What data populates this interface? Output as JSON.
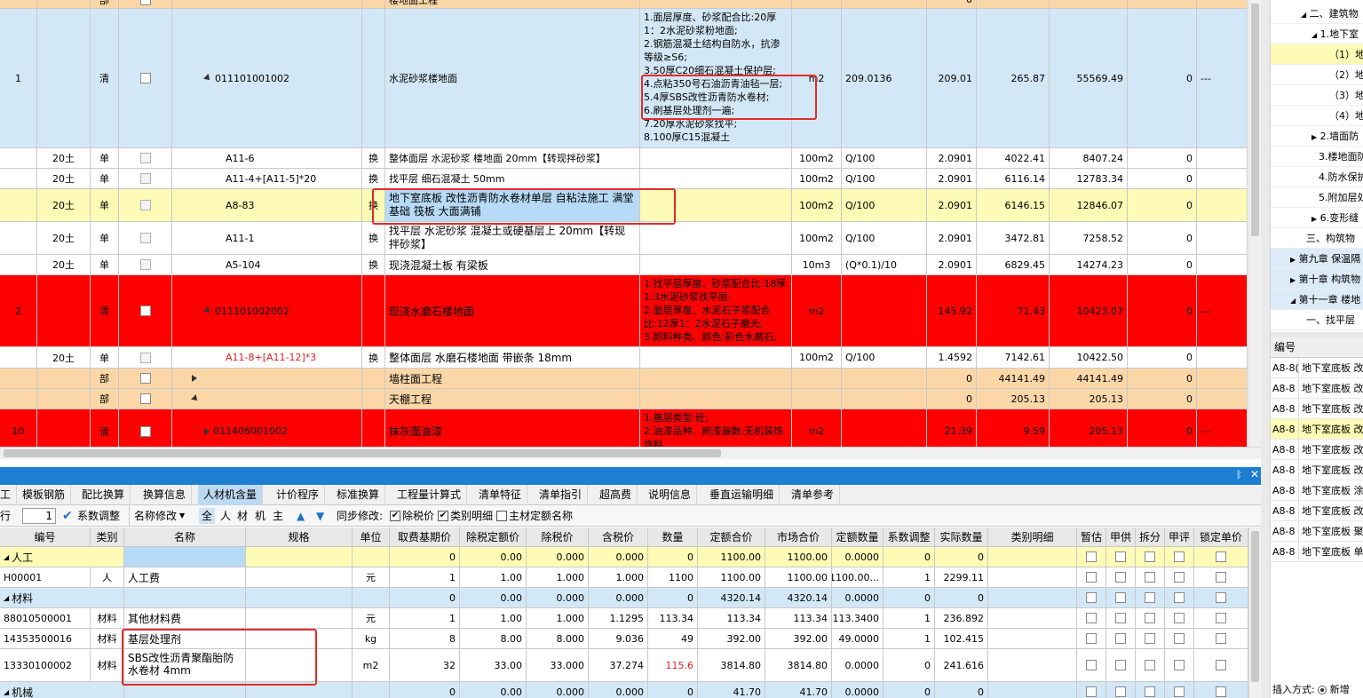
{
  "top_grid": {
    "rows": [
      {
        "code": "",
        "type": "部",
        "name": "楼地面工程",
        "amount": "0",
        "v1": "",
        "v2": ""
      },
      {
        "idx": "1",
        "type": "清",
        "code": "011101001002",
        "name": "水泥砂浆楼地面",
        "features": "1.面层厚度、砂浆配合比:20厚1：2水泥砂浆粉地面;\n2.钢筋混凝土结构自防水，抗渗等级≥S6;\n3.50厚C20细石混凝土保护层;\n4.点粘350号石油沥青油毡一层;\n5.4厚SBS改性沥青防水卷材;\n6.刷基层处理剂一遍;\n7.20厚水泥砂浆找平;\n8.100厚C15混凝土",
        "unit": "m2",
        "expr": "209.0136",
        "qty": "209.01",
        "price": "265.87",
        "total": "55569.49",
        "last": "0",
        "dash": "---"
      },
      {
        "major": "20土",
        "type": "单",
        "code": "A11-6",
        "huan": "换",
        "name": "整体面层 水泥砂浆 楼地面 20mm【转现拌砂浆】",
        "unit": "100m2",
        "expr": "Q/100",
        "qty": "2.0901",
        "price": "4022.41",
        "total": "8407.24",
        "last": "0"
      },
      {
        "major": "20土",
        "type": "单",
        "code": "A11-4+[A11-5]*20",
        "huan": "换",
        "name": "找平层 细石混凝土 50mm",
        "unit": "100m2",
        "expr": "Q/100",
        "qty": "2.0901",
        "price": "6116.14",
        "total": "12783.34",
        "last": "0"
      },
      {
        "major": "20土",
        "type": "单",
        "code": "A8-83",
        "huan": "换",
        "name": "地下室底板 改性沥青防水卷材单层 自粘法施工 满堂基础 筏板 大面满铺",
        "unit": "100m2",
        "expr": "Q/100",
        "qty": "2.0901",
        "price": "6146.15",
        "total": "12846.07",
        "last": "0"
      },
      {
        "major": "20土",
        "type": "单",
        "code": "A11-1",
        "huan": "换",
        "name": "找平层 水泥砂浆 混凝土或硬基层上 20mm【转现拌砂浆】",
        "unit": "100m2",
        "expr": "Q/100",
        "qty": "2.0901",
        "price": "3472.81",
        "total": "7258.52",
        "last": "0"
      },
      {
        "major": "20土",
        "type": "单",
        "code": "A5-104",
        "huan": "换",
        "name": "现浇混凝土板 有梁板",
        "unit": "10m3",
        "expr": "(Q*0.1)/10",
        "qty": "2.0901",
        "price": "6829.45",
        "total": "14274.23",
        "last": "0"
      },
      {
        "idx": "2",
        "type": "清",
        "code": "011101002002",
        "name": "现浇水磨石楼地面",
        "features": "1.找平层厚度、砂浆配合比:18厚1:3水泥砂浆找平层;\n2.面层厚度、水泥石子浆配合比:12厚1：2水泥石子磨光;\n3.颜料种类、颜色:彩色水磨石;",
        "unit": "m2",
        "qty": "145.92",
        "price": "71.43",
        "total": "10423.07",
        "last": "0",
        "dash": "---"
      },
      {
        "major": "20土",
        "type": "单",
        "code": "A11-8+[A11-12]*3",
        "huan": "换",
        "name": "整体面层 水磨石楼地面 带嵌条 18mm",
        "unit": "100m2",
        "expr": "Q/100",
        "qty": "1.4592",
        "price": "7142.61",
        "total": "10422.50",
        "last": "0"
      },
      {
        "type": "部",
        "name": "墙柱面工程",
        "qty": "0",
        "price": "44141.49",
        "total": "44141.49",
        "last": "0"
      },
      {
        "type": "部",
        "name": "天棚工程",
        "qty": "0",
        "price": "205.13",
        "total": "205.13",
        "last": "0"
      },
      {
        "idx": "10",
        "type": "清",
        "code": "011406001002",
        "name": "抹灰面油漆",
        "features": "1.基层类型:砼;\n2.油漆品种、刷漆遍数:无机装饰涂料",
        "unit": "m2",
        "qty": "21.39",
        "price": "9.59",
        "total": "205.13",
        "last": "0",
        "dash": "---"
      }
    ]
  },
  "right_panel": {
    "tree": [
      "二、建筑物",
      "1.地下室",
      "（1）地",
      "（2）地",
      "（3）地",
      "（4）地",
      "2.墙面防",
      "3.楼地面防",
      "4.防水保护",
      "5.附加层处",
      "6.变形缝",
      "三、构筑物",
      "第九章 保温隔",
      "第十章 构筑物",
      "第十一章 楼地",
      "一、找平层"
    ],
    "list_header": "编号",
    "list": [
      {
        "code": "A8-8(",
        "name": "地下室底板 改"
      },
      {
        "code": "A8-8",
        "name": "地下室底板 改"
      },
      {
        "code": "A8-8",
        "name": "地下室底板 改"
      },
      {
        "code": "A8-8",
        "name": "地下室底板 改"
      },
      {
        "code": "A8-8",
        "name": "地下室底板 改"
      },
      {
        "code": "A8-8",
        "name": "地下室底板 改"
      },
      {
        "code": "A8-8",
        "name": "地下室底板 涂"
      },
      {
        "code": "A8-8",
        "name": "地下室底板 改"
      },
      {
        "code": "A8-8",
        "name": "地下室底板 聚"
      },
      {
        "code": "A8-8",
        "name": "地下室底板 单"
      }
    ],
    "insert_label": "插入方式:",
    "insert_option": "新增"
  },
  "tabs": [
    "工",
    "模板钢筋",
    "配比换算",
    "换算信息",
    "人材机含量",
    "计价程序",
    "标准换算",
    "工程量计算式",
    "清单特征",
    "清单指引",
    "超高费",
    "说明信息",
    "垂直运输明细",
    "清单参考"
  ],
  "toolbar": {
    "row_label": "行",
    "row_value": "1",
    "coef_adjust": "系数调整",
    "name_modify": "名称修改",
    "filters": [
      "全",
      "人",
      "材",
      "机",
      "主"
    ],
    "sync_label": "同步修改:",
    "opt1": "除税价",
    "opt2": "类别明细",
    "opt3": "主材定额名称"
  },
  "bottom_grid": {
    "headers": [
      "编号",
      "类别",
      "名称",
      "规格",
      "单位",
      "取费基期价",
      "除税定额价",
      "除税价",
      "含税价",
      "数量",
      "定额合价",
      "市场合价",
      "定额数量",
      "系数调整",
      "实际数量",
      "类别明细",
      "暂估",
      "甲供",
      "拆分",
      "甲评",
      "锁定单价"
    ],
    "rows": [
      {
        "group": "人工",
        "base": "0",
        "p1": "0.00",
        "p2": "0.000",
        "p3": "0.000",
        "qty": "0",
        "t1": "1100.00",
        "t2": "1100.00",
        "dq": "0.0000",
        "coef": "0",
        "aq": "0"
      },
      {
        "code": "H00001",
        "cat": "人",
        "name": "人工费",
        "unit": "元",
        "base": "1",
        "p1": "1.00",
        "p2": "1.000",
        "p3": "1.000",
        "qty": "1100",
        "t1": "1100.00",
        "t2": "1100.00",
        "dq": "1100.00...",
        "coef": "1",
        "aq": "2299.11"
      },
      {
        "group": "材料",
        "base": "0",
        "p1": "0.00",
        "p2": "0.000",
        "p3": "0.000",
        "qty": "0",
        "t1": "4320.14",
        "t2": "4320.14",
        "dq": "0.0000",
        "coef": "0",
        "aq": "0"
      },
      {
        "code": "88010500001",
        "cat": "材料",
        "name": "其他材料费",
        "unit": "元",
        "base": "1",
        "p1": "1.00",
        "p2": "1.000",
        "p3": "1.1295",
        "qty": "113.34",
        "t1": "113.34",
        "t2": "113.34",
        "dq": "113.3400",
        "coef": "1",
        "aq": "236.892"
      },
      {
        "code": "14353500016",
        "cat": "材料",
        "name": "基层处理剂",
        "unit": "kg",
        "base": "8",
        "p1": "8.00",
        "p2": "8.000",
        "p3": "9.036",
        "qty": "49",
        "t1": "392.00",
        "t2": "392.00",
        "dq": "49.0000",
        "coef": "1",
        "aq": "102.415"
      },
      {
        "code": "13330100002",
        "cat": "材料",
        "name": "SBS改性沥青聚酯胎防水卷材 4mm",
        "unit": "m2",
        "base": "32",
        "p1": "33.00",
        "p2": "33.000",
        "p3": "37.274",
        "qty": "115.6",
        "t1": "3814.80",
        "t2": "3814.80",
        "dq": "0.0000",
        "coef": "0",
        "aq": "241.616"
      },
      {
        "group": "机械",
        "base": "0",
        "p1": "0.00",
        "p2": "0.000",
        "p3": "0.000",
        "qty": "0",
        "t1": "41.70",
        "t2": "41.70",
        "dq": "0.0000",
        "coef": "0",
        "aq": "0"
      }
    ]
  },
  "colors": {
    "orange": "#fbd7a8",
    "lightblue": "#d3e8f6",
    "yellow": "#fdfbb5",
    "red": "#ff0000",
    "selected": "#b7dbf7",
    "accent": "#1d7fd2"
  }
}
